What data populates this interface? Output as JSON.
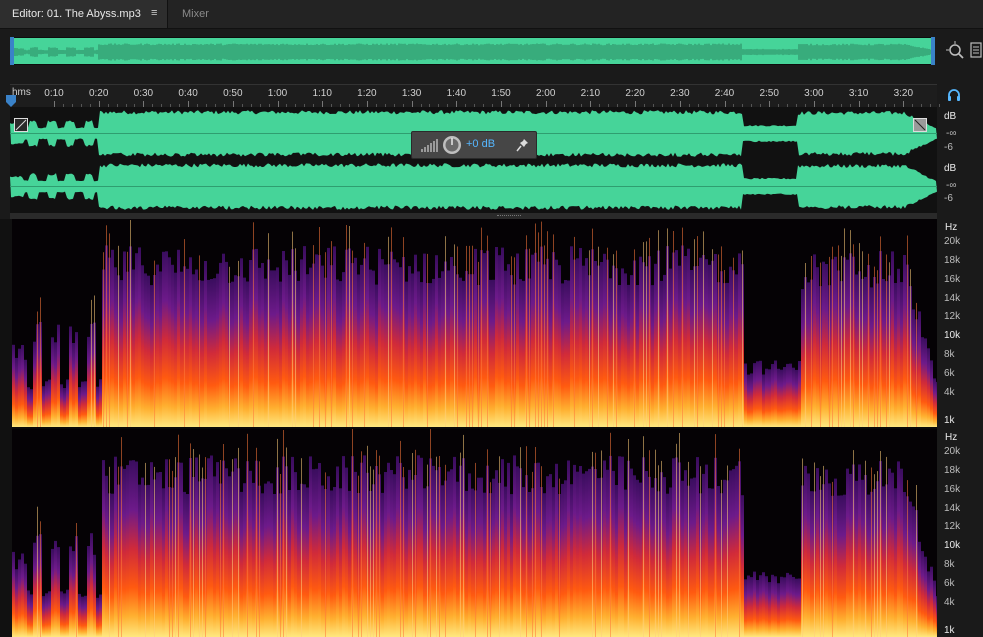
{
  "tabs": {
    "editor_label": "Editor: 01. The Abyss.mp3",
    "editor_menu_glyph": "≡",
    "mixer_label": "Mixer"
  },
  "ruler": {
    "unit_label": "hms",
    "ticks": [
      "0:10",
      "0:20",
      "0:30",
      "0:40",
      "0:50",
      "1:00",
      "1:10",
      "1:20",
      "1:30",
      "1:40",
      "1:50",
      "2:00",
      "2:10",
      "2:20",
      "2:30",
      "2:40",
      "2:50",
      "3:00",
      "3:10",
      "3:20"
    ]
  },
  "volume_hud": {
    "value": "+0 dB"
  },
  "amplitude_scale": {
    "unit": "dB",
    "labels": [
      "-∞",
      "-6"
    ]
  },
  "frequency_scale": {
    "unit": "Hz",
    "labels": [
      "20k",
      "18k",
      "16k",
      "14k",
      "12k",
      "10k",
      "8k",
      "6k",
      "4k",
      "1k"
    ]
  },
  "colors": {
    "waveform": "#46d499",
    "selection_handle": "#3a82c8",
    "accent_blue": "#56b7ff"
  },
  "icons": [
    "playhead-marker-icon",
    "zoom-icon",
    "panel-icon",
    "headphones-icon",
    "volume-meter-icon",
    "volume-knob-icon",
    "pin-icon",
    "fade-in-icon",
    "fade-out-icon",
    "menu-icon"
  ]
}
